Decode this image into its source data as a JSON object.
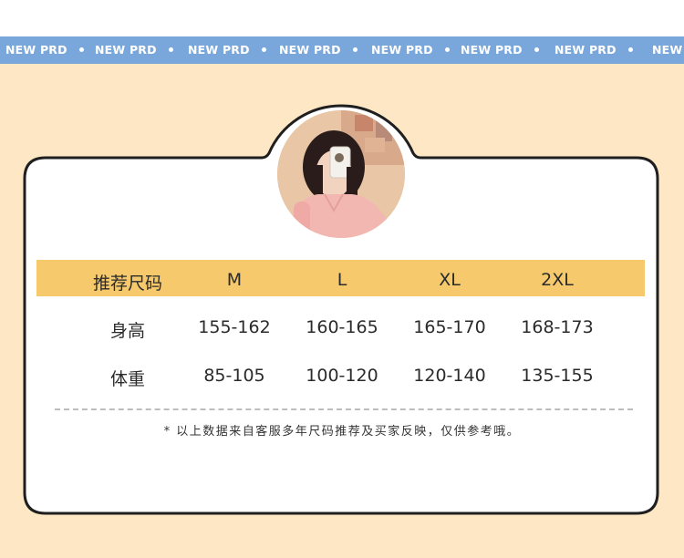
{
  "ticker": {
    "items": [
      "NEW PRD",
      "NEW PRD",
      "NEW PRD",
      "NEW PRD",
      "NEW PRD",
      "NEW PRD",
      "NEW PRD",
      "NEW PRD"
    ]
  },
  "colors": {
    "ticker_bg": "#7aa7db",
    "page_bg": "#fde7c5",
    "header_bar": "#f5c96c",
    "card_border": "#1f1f1f"
  },
  "table": {
    "header": [
      "推荐尺码",
      "M",
      "L",
      "XL",
      "2XL"
    ],
    "rows": [
      {
        "label": "身高",
        "values": [
          "155-162",
          "160-165",
          "165-170",
          "168-173"
        ]
      },
      {
        "label": "体重",
        "values": [
          "85-105",
          "100-120",
          "120-140",
          "135-155"
        ]
      }
    ]
  },
  "note": "* 以上数据来自客服多年尺码推荐及买家反映，仅供参考哦。"
}
